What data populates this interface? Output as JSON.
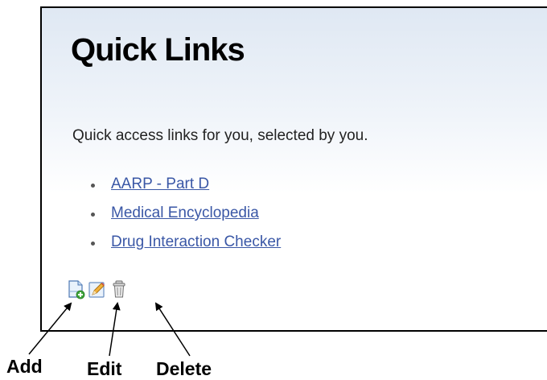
{
  "widget": {
    "title": "Quick Links",
    "description": "Quick access links for you, selected by you.",
    "links": [
      {
        "label": "AARP - Part D"
      },
      {
        "label": "Medical Encyclopedia"
      },
      {
        "label": "Drug Interaction Checker"
      }
    ],
    "tools": [
      {
        "icon": "add-page-icon"
      },
      {
        "icon": "pencil-edit-icon"
      },
      {
        "icon": "trash-can-icon"
      }
    ]
  },
  "callouts": {
    "add": "Add",
    "edit": "Edit",
    "delete": "Delete"
  },
  "colors": {
    "link": "#3a57a6",
    "panel_gradient_top": "#dfe8f3",
    "panel_border": "#000000"
  }
}
